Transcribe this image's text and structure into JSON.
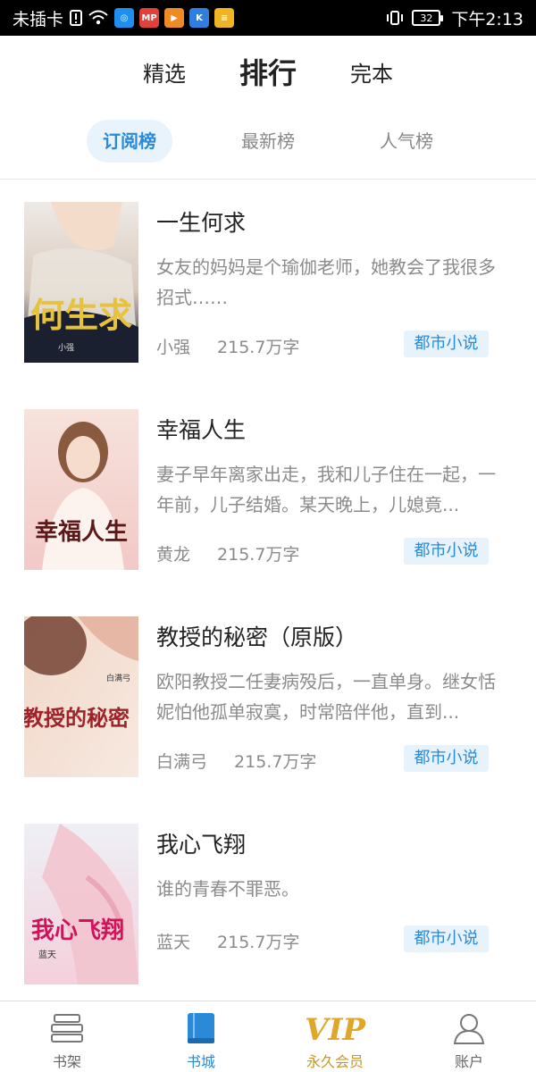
{
  "status_bar": {
    "carrier": "未插卡",
    "battery": "32",
    "time": "下午2:13",
    "app_icons": [
      {
        "name": "browser-app-icon",
        "color": "#1e8ff0",
        "glyph": "◎"
      },
      {
        "name": "mp-app-icon",
        "color": "#e2403a",
        "glyph": "MP"
      },
      {
        "name": "play-app-icon",
        "color": "#f08a24",
        "glyph": "▶"
      },
      {
        "name": "k-app-icon",
        "color": "#2f7fe0",
        "glyph": "K"
      },
      {
        "name": "more-app-icon",
        "color": "#f0b323",
        "glyph": "≡"
      }
    ]
  },
  "top_tabs": [
    "精选",
    "排行",
    "完本"
  ],
  "sub_tabs": [
    "订阅榜",
    "最新榜",
    "人气榜"
  ],
  "books": [
    {
      "title": "一生何求",
      "desc": "女友的妈妈是个瑜伽老师，她教会了我很多招式……",
      "author": "小强",
      "words": "215.7万字",
      "tag": "都市小说",
      "cover_text": "何生求",
      "cover_sub": "小强"
    },
    {
      "title": "幸福人生",
      "desc": "妻子早年离家出走，我和儿子住在一起，一年前，儿子结婚。某天晚上，儿媳竟...",
      "author": "黄龙",
      "words": "215.7万字",
      "tag": "都市小说",
      "cover_text": "幸福人生",
      "cover_sub": ""
    },
    {
      "title": "教授的秘密（原版）",
      "desc": "欧阳教授二任妻病殁后，一直单身。继女恬妮怕他孤单寂寞，时常陪伴他，直到...",
      "author": "白满弓",
      "words": "215.7万字",
      "tag": "都市小说",
      "cover_text": "教授的秘密",
      "cover_sub": "白满弓"
    },
    {
      "title": "我心飞翔",
      "desc": "谁的青春不罪恶。",
      "author": "蓝天",
      "words": "215.7万字",
      "tag": "都市小说",
      "cover_text": "我心飞翔",
      "cover_sub": "蓝天"
    }
  ],
  "bottom_nav": [
    {
      "label": "书架",
      "icon": "bookshelf-icon"
    },
    {
      "label": "书城",
      "icon": "bookstore-icon"
    },
    {
      "label": "永久会员",
      "icon": "vip-icon"
    },
    {
      "label": "账户",
      "icon": "account-icon"
    }
  ],
  "colors": {
    "accent": "#2a8ad8",
    "vip": "#c9962b",
    "tag_bg": "#e7f2fb"
  }
}
